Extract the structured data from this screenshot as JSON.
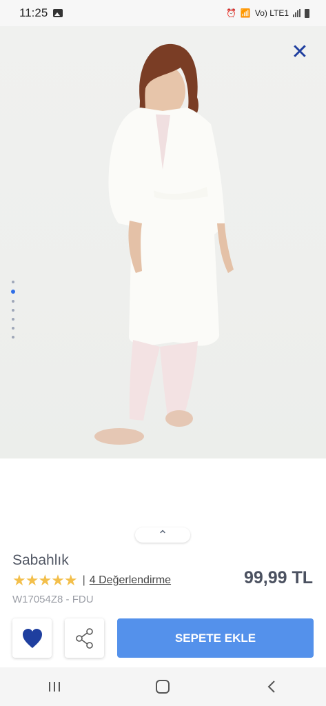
{
  "status": {
    "time": "11:25",
    "network": "Vo) LTE1"
  },
  "product": {
    "title": "Sabahlık",
    "rating_stars": "★★★★★",
    "rating_separator": "|",
    "reviews_text": "4 Değerlendirme",
    "price": "99,99 TL",
    "sku": "W17054Z8 - FDU"
  },
  "gallery": {
    "dot_count": 7,
    "active_index": 1
  },
  "actions": {
    "cart_label": "SEPETE EKLE"
  },
  "colors": {
    "accent": "#5491eb",
    "heart": "#1f3f9f",
    "close": "#1f3f9f",
    "stars": "#f3bf4b"
  },
  "icons": {
    "close": "close-icon",
    "expand": "chevron-up-icon",
    "favorite": "heart-icon",
    "share": "share-icon",
    "recent": "recent-apps-icon",
    "home": "home-icon",
    "back": "back-icon"
  }
}
